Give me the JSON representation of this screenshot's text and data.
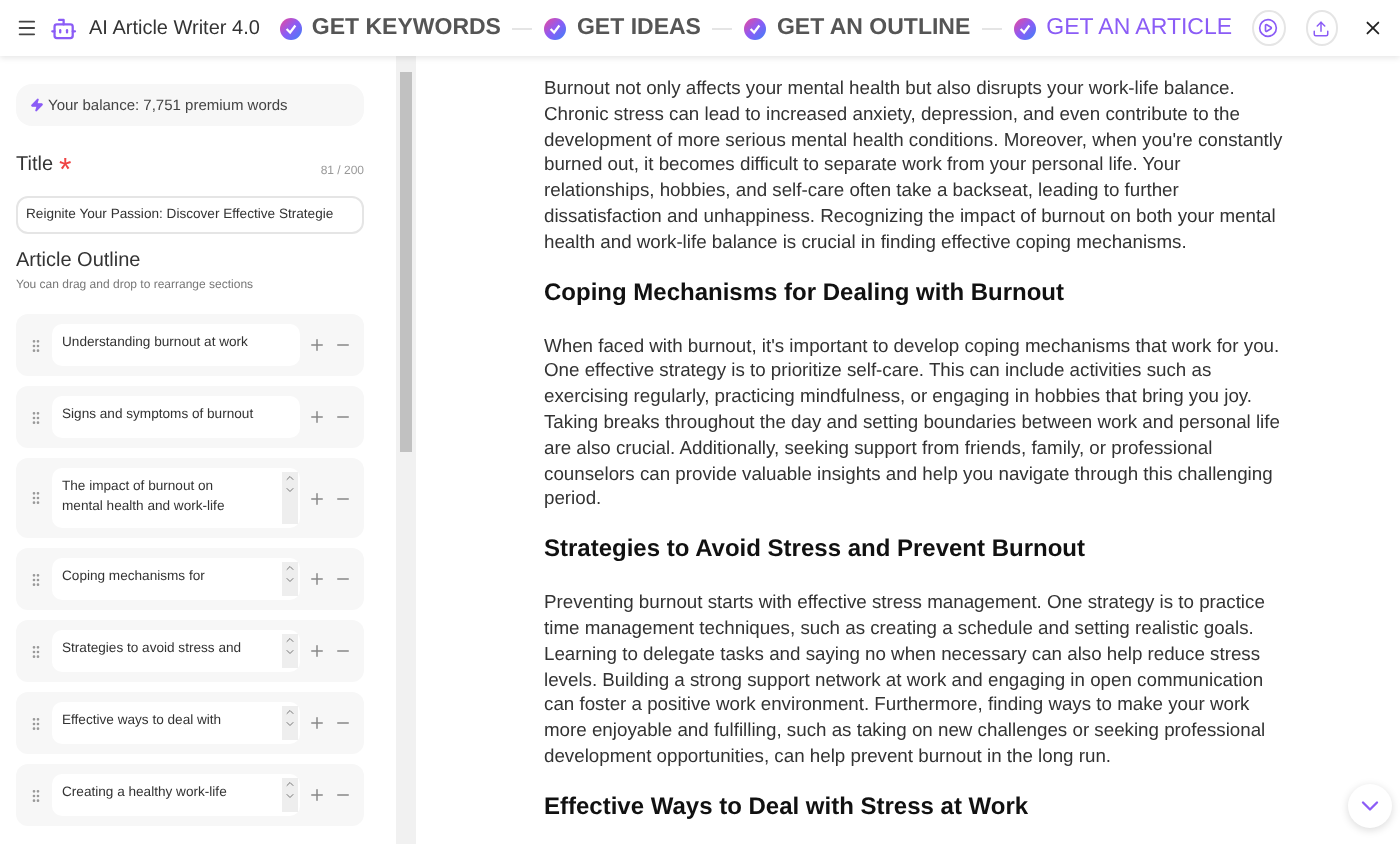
{
  "app": {
    "title": "AI Article Writer 4.0"
  },
  "steps": [
    {
      "label": "GET KEYWORDS",
      "selected": false
    },
    {
      "label": "GET IDEAS",
      "selected": false
    },
    {
      "label": "GET AN OUTLINE",
      "selected": false
    },
    {
      "label": "GET AN ARTICLE",
      "selected": true
    }
  ],
  "sidebar": {
    "balance": "Your balance: 7,751 premium words",
    "title_label": "Title",
    "required_mark": "*",
    "title_counter": "81 / 200",
    "title_value": "Reignite Your Passion: Discover Effective Strategie",
    "outline_label": "Article Outline",
    "outline_hint": "You can drag and drop to rearrange sections",
    "sections": [
      {
        "lines": [
          "Understanding burnout at work"
        ],
        "scroll": false
      },
      {
        "lines": [
          "Signs and symptoms of burnout"
        ],
        "scroll": false
      },
      {
        "lines": [
          "The impact of burnout on",
          "mental health and work-life"
        ],
        "scroll": true
      },
      {
        "lines": [
          "Coping mechanisms for"
        ],
        "scroll": true
      },
      {
        "lines": [
          "Strategies to avoid stress and"
        ],
        "scroll": true
      },
      {
        "lines": [
          "Effective ways to deal with"
        ],
        "scroll": true
      },
      {
        "lines": [
          "Creating a healthy work-life"
        ],
        "scroll": true
      }
    ]
  },
  "article": [
    {
      "kind": "paragraph",
      "text": "Burnout not only affects your mental health but also disrupts your work-life balance. Chronic stress can lead to increased anxiety, depression, and even contribute to the development of more serious mental health conditions. Moreover, when you're constantly burned out, it becomes difficult to separate work from your personal life. Your relationships, hobbies, and self-care often take a backseat, leading to further dissatisfaction and unhappiness. Recognizing the impact of burnout on both your mental health and work-life balance is crucial in finding effective coping mechanisms."
    },
    {
      "kind": "heading",
      "text": "Coping Mechanisms for Dealing with Burnout"
    },
    {
      "kind": "paragraph",
      "text": "When faced with burnout, it's important to develop coping mechanisms that work for you. One effective strategy is to prioritize self-care. This can include activities such as exercising regularly, practicing mindfulness, or engaging in hobbies that bring you joy. Taking breaks throughout the day and setting boundaries between work and personal life are also crucial. Additionally, seeking support from friends, family, or professional counselors can provide valuable insights and help you navigate through this challenging period."
    },
    {
      "kind": "heading",
      "text": "Strategies to Avoid Stress and Prevent Burnout"
    },
    {
      "kind": "paragraph",
      "text": "Preventing burnout starts with effective stress management. One strategy is to practice time management techniques, such as creating a schedule and setting realistic goals. Learning to delegate tasks and saying no when necessary can also help reduce stress levels. Building a strong support network at work and engaging in open communication can foster a positive work environment. Furthermore, finding ways to make your work more enjoyable and fulfilling, such as taking on new challenges or seeking professional development opportunities, can help prevent burnout in the long run."
    },
    {
      "kind": "heading",
      "text": "Effective Ways to Deal with Stress at Work"
    }
  ]
}
